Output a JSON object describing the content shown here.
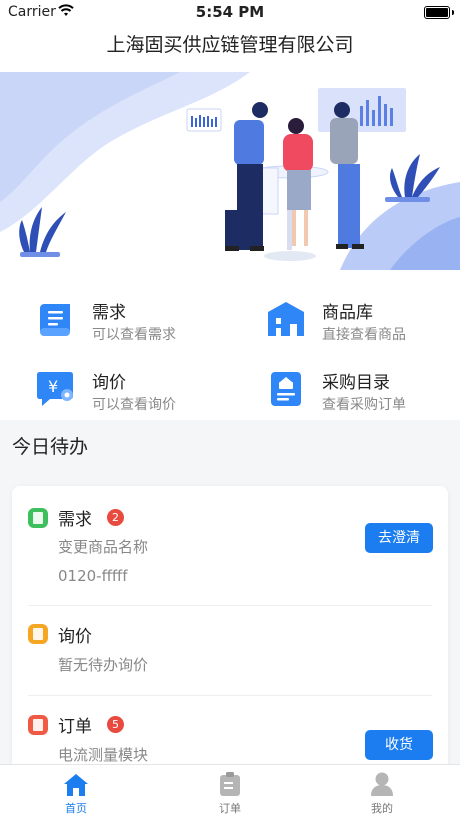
{
  "status_bar": {
    "carrier": "Carrier",
    "time": "5:54 PM"
  },
  "header": {
    "title": "上海固买供应链管理有限公司"
  },
  "menu": [
    {
      "title": "需求",
      "subtitle": "可以查看需求",
      "icon": "scroll-list-icon"
    },
    {
      "title": "商品库",
      "subtitle": "直接查看商品",
      "icon": "warehouse-icon"
    },
    {
      "title": "询价",
      "subtitle": "可以查看询价",
      "icon": "price-chat-icon"
    },
    {
      "title": "采购目录",
      "subtitle": "查看采购订单",
      "icon": "basket-document-icon"
    }
  ],
  "today": {
    "title": "今日待办",
    "items": [
      {
        "name": "需求",
        "badge": "2",
        "lines": [
          "变更商品名称",
          "0120-fffff"
        ],
        "button": "去澄清",
        "color": "#3cbf5c"
      },
      {
        "name": "询价",
        "lines": [
          "暂无待办询价"
        ],
        "color": "#f5a623"
      },
      {
        "name": "订单",
        "badge": "5",
        "lines": [
          "电流测量模块"
        ],
        "button": "收货",
        "color": "#ef5a44"
      }
    ]
  },
  "tabbar": [
    {
      "label": "首页",
      "icon": "home-icon",
      "active": true
    },
    {
      "label": "订单",
      "icon": "order-clipboard-icon",
      "active": false
    },
    {
      "label": "我的",
      "icon": "profile-icon",
      "active": false
    }
  ],
  "colors": {
    "accent": "#1b7df0",
    "badge": "#e84a40"
  }
}
